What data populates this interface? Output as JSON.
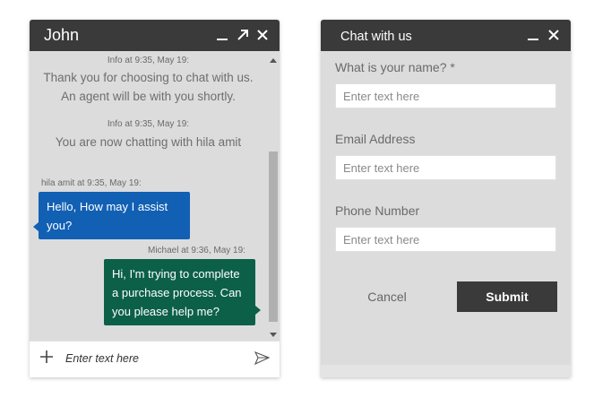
{
  "chat": {
    "title": "John",
    "messages": [
      {
        "type": "system",
        "meta": "Info at 9:35, May 19:",
        "text_line1": "Thank you for choosing to chat with us.",
        "text_line2": "An agent will be with you shortly."
      },
      {
        "type": "system",
        "meta": "Info at 9:35, May 19:",
        "text": "You are now chatting with hila amit"
      },
      {
        "type": "agent",
        "meta": "hila amit at 9:35, May 19:",
        "text": "Hello, How may I assist you?"
      },
      {
        "type": "user",
        "meta": "Michael at 9:36, May 19:",
        "text": "Hi, I'm trying to complete a purchase process. Can you please help me?"
      }
    ],
    "input_placeholder": "Enter text here",
    "icons": [
      "minimize-icon",
      "popout-icon",
      "close-icon",
      "plus-icon",
      "send-icon",
      "scroll-up-icon",
      "scroll-down-icon"
    ]
  },
  "form": {
    "title": "Chat with us",
    "fields": [
      {
        "label": "What is your name? *",
        "placeholder": "Enter text here"
      },
      {
        "label": "Email Address",
        "placeholder": "Enter text here"
      },
      {
        "label": "Phone Number",
        "placeholder": "Enter text here"
      }
    ],
    "cancel_label": "Cancel",
    "submit_label": "Submit"
  },
  "colors": {
    "header_bg": "#3a3a3a",
    "window_bg": "#dcdcdc",
    "agent_bubble": "#1160b4",
    "user_bubble": "#0c6048"
  }
}
